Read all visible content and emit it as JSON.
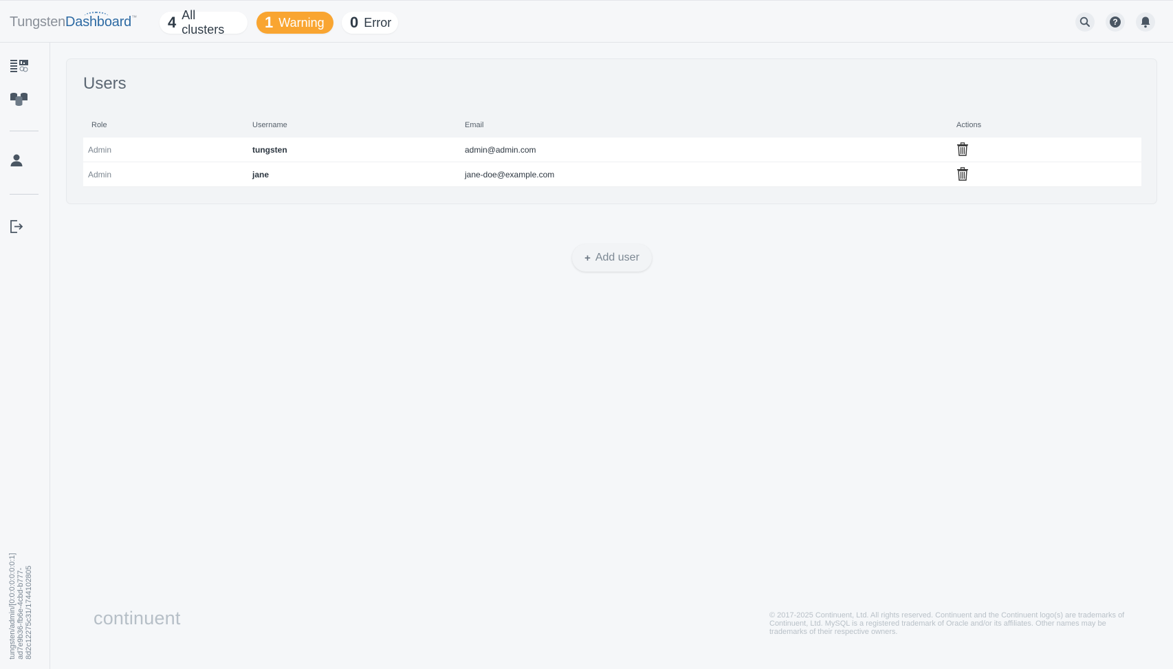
{
  "header": {
    "logo_part1": "Tungsten",
    "logo_part2": "Dashboard",
    "logo_tm": "™",
    "status": {
      "all_count": "4",
      "all_label": "All clusters",
      "warning_count": "1",
      "warning_label": "Warning",
      "error_count": "0",
      "error_label": "Error"
    },
    "colors": {
      "warning": "#f9a531",
      "brand": "#2d6aa3"
    }
  },
  "sidebar": {
    "icons": [
      "dashboard-overview-icon",
      "clusters-icon",
      "users-icon",
      "logout-icon"
    ],
    "version_text": "tungsten/admin/[0:0:0:0:0:0:0:1] ad7e9b36-fb6e-4cbd-b777-8d2c12275c31/1744102805"
  },
  "users": {
    "title": "Users",
    "columns": {
      "role": "Role",
      "username": "Username",
      "email": "Email",
      "actions": "Actions"
    },
    "rows": [
      {
        "role": "Admin",
        "username": "tungsten",
        "email": "admin@admin.com"
      },
      {
        "role": "Admin",
        "username": "jane",
        "email": "jane-doe@example.com"
      }
    ]
  },
  "add_user": {
    "plus": "+",
    "label": "Add user"
  },
  "footer": {
    "logo": "continuent",
    "copyright": "© 2017-2025 Continuent, Ltd. All rights reserved. Continuent and the Continuent logo(s) are trademarks of Continuent, Ltd. MySQL is a registered trademark of Oracle and/or its affiliates. Other names may be trademarks of their respective owners."
  }
}
